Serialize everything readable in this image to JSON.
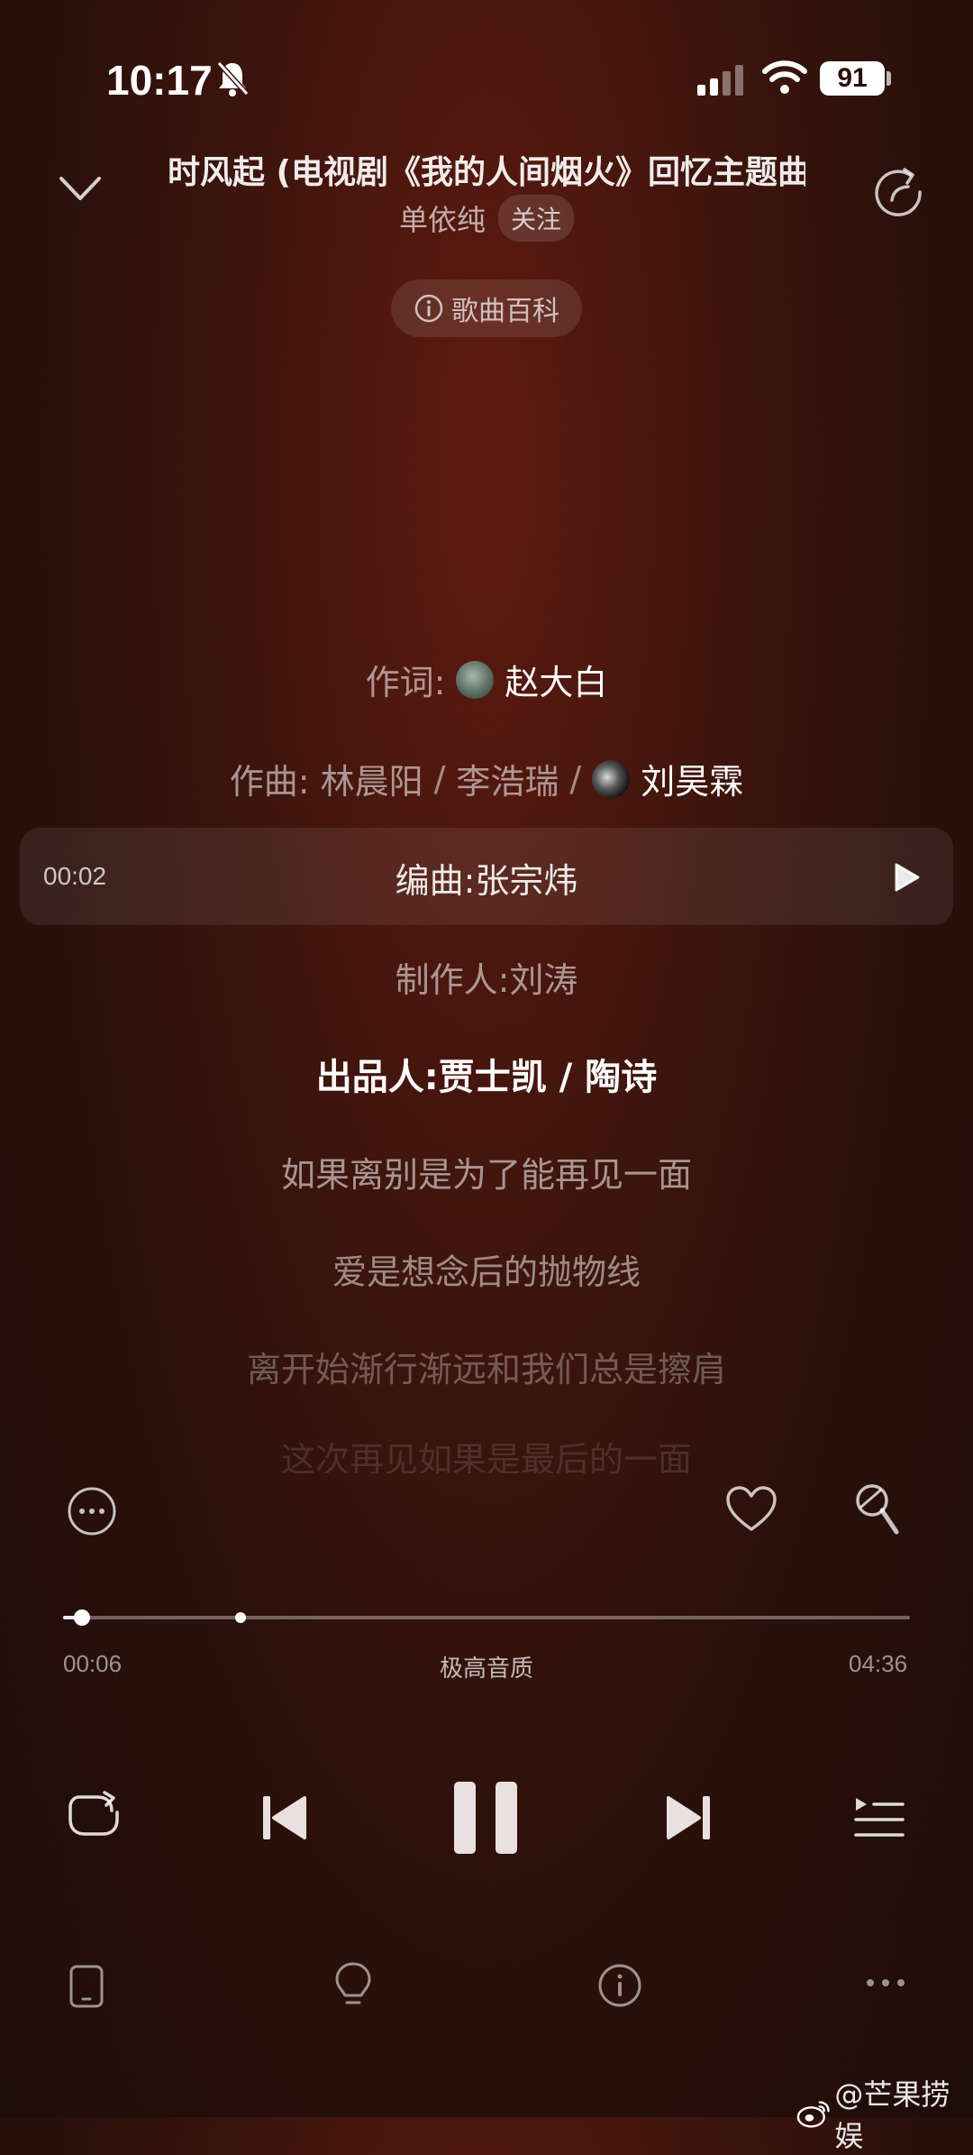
{
  "status_bar": {
    "time": "10:17",
    "battery": "91",
    "icons": [
      "bell-muted-icon",
      "signal-icon",
      "wifi-icon",
      "battery-icon"
    ]
  },
  "header": {
    "title": "时风起 (电视剧《我的人间烟火》回忆主题曲",
    "artist": "单依纯",
    "follow_label": "关注",
    "wiki_label": "歌曲百科",
    "icons": [
      "chevron-down-icon",
      "share-icon",
      "info-icon"
    ]
  },
  "lyrics": {
    "lyricist_label": "作词:",
    "lyricist": "赵大白",
    "composer_label": "作曲:",
    "composers": [
      "林晨阳",
      "李浩瑞",
      "刘昊霖"
    ],
    "separator": "/",
    "current_time": "00:02",
    "arranger_line": "编曲:张宗炜",
    "producer_line": "制作人:刘涛",
    "publisher_line": "出品人:贾士凯 / 陶诗",
    "lines": [
      "如果离别是为了能再见一面",
      "爱是想念后的抛物线",
      "离开始渐行渐远和我们总是擦肩",
      "这次再见如果是最后的一面"
    ]
  },
  "actions": {
    "icons": [
      "more-circle-icon",
      "heart-icon",
      "mic-icon"
    ]
  },
  "playback": {
    "elapsed": "00:06",
    "duration": "04:36",
    "quality": "极高音质",
    "progress": 0.022,
    "buffered": 0.21
  },
  "controls": {
    "icons": [
      "repeat-icon",
      "previous-icon",
      "pause-icon",
      "next-icon",
      "playlist-icon"
    ]
  },
  "bottom_bar": {
    "icons": [
      "device-icon",
      "bulb-icon",
      "info-icon",
      "more-icon"
    ]
  },
  "watermark": {
    "text": "@芒果捞娱",
    "icon": "weibo-icon"
  }
}
